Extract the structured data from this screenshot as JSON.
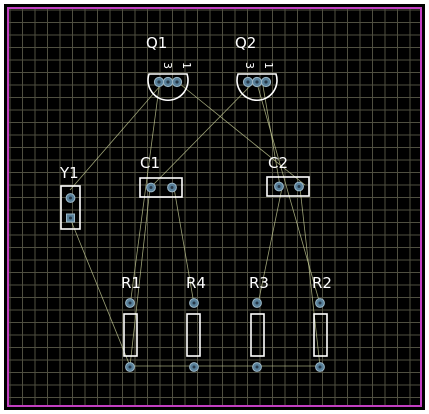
{
  "board": {
    "background_color": "#000000",
    "grid_color": "#4f4f40",
    "outline_color": "#c23fc2",
    "silkscreen_color": "#ffffff",
    "pad_color": "#58809a",
    "ratsnest_color": "#cfd69c"
  },
  "components": {
    "q1": {
      "designator": "Q1",
      "pin3": "3",
      "pin1": "1"
    },
    "q2": {
      "designator": "Q2",
      "pin3": "3",
      "pin1": "1"
    },
    "c1": {
      "designator": "C1"
    },
    "c2": {
      "designator": "C2"
    },
    "y1": {
      "designator": "Y1"
    },
    "r1": {
      "designator": "R1"
    },
    "r4": {
      "designator": "R4"
    },
    "r3": {
      "designator": "R3"
    },
    "r2": {
      "designator": "R2"
    }
  }
}
